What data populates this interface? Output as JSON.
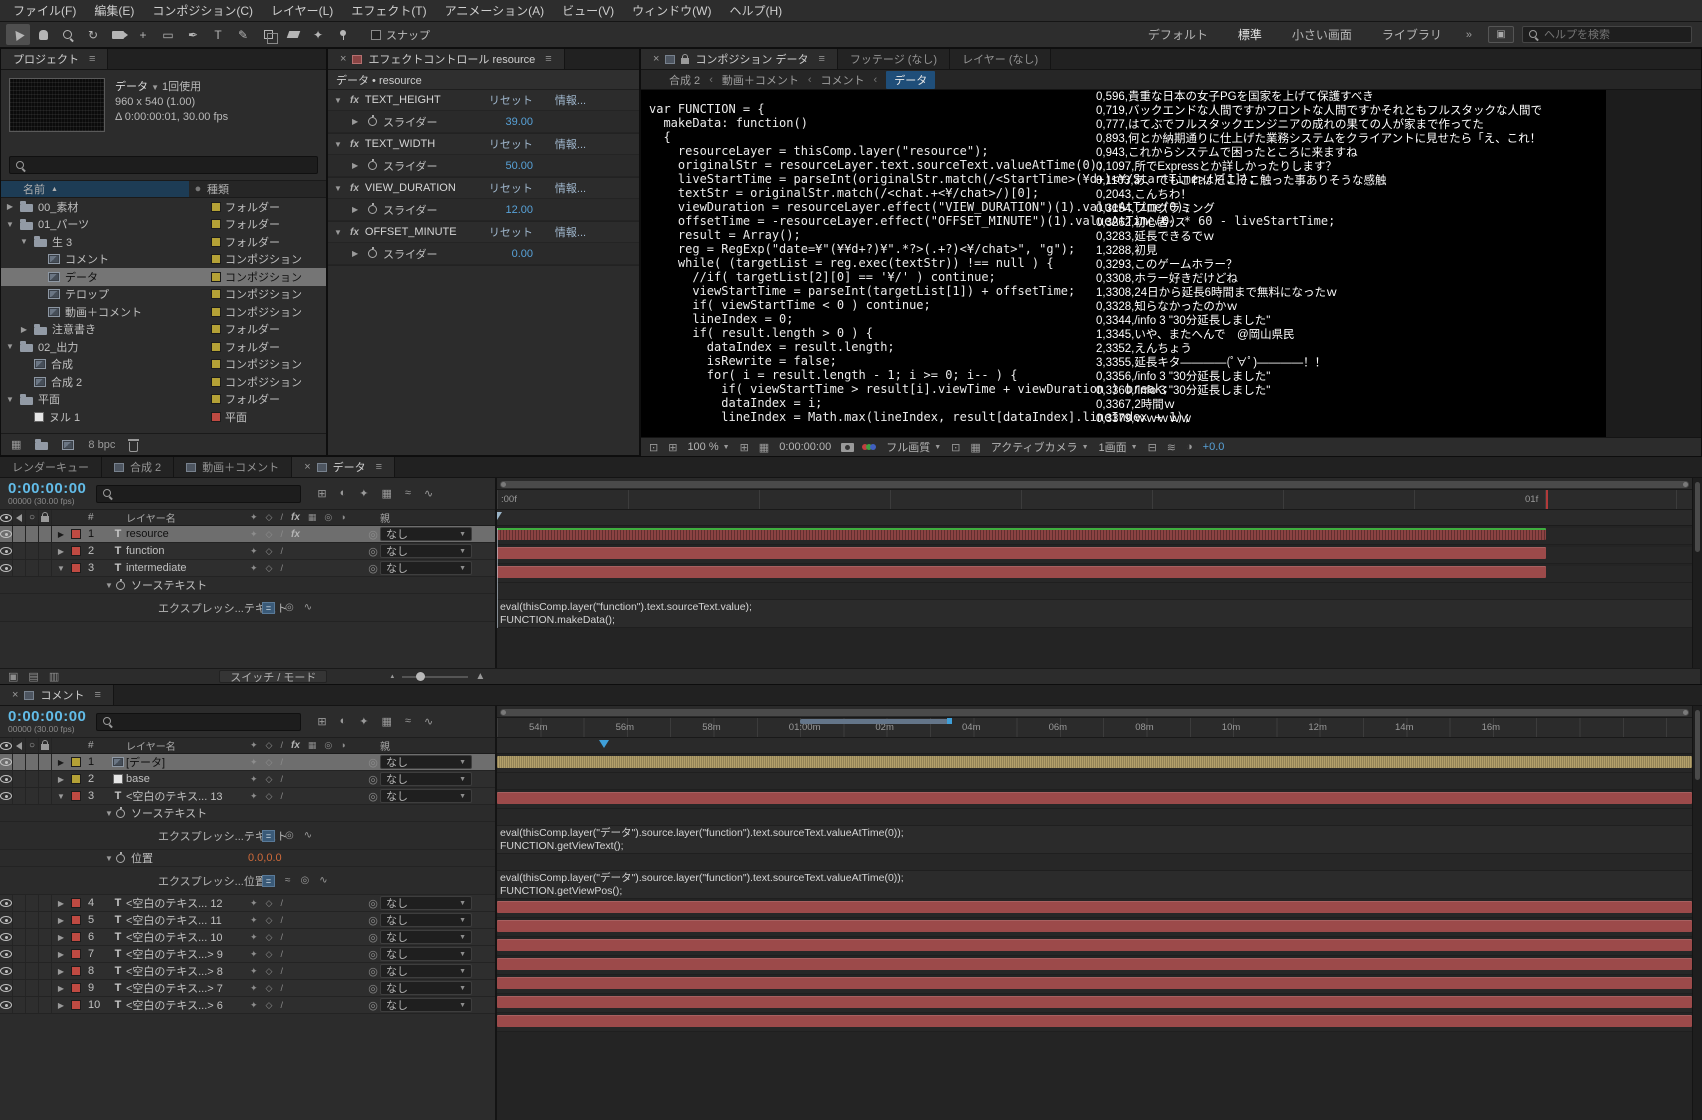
{
  "colors": {
    "accent_blue": "#3f9fd8",
    "time_cyan": "#62bce8",
    "bar_red": "#9c4a4a",
    "bar_tan": "#b3a06a",
    "bar_green_line": "#3fae3f",
    "label_red": "#bf4a42",
    "label_yellow": "#b4a136",
    "crumb_active_bg": "#1f4e79"
  },
  "icons": {
    "menu": "≡",
    "close": "×",
    "caret_down": "▼",
    "arrow_right": "▶",
    "arrow_down": "▼",
    "sort_asc": "▲",
    "pickwhip": "◎",
    "graph": "∿",
    "eq": "=",
    "wave": "≈",
    "crumb_sep": "‹",
    "overflow": "»",
    "solo": "○",
    "text_layer": "T",
    "switch_a": "✦",
    "switch_b": "◇",
    "switch_c": "/",
    "fx": "fx",
    "mon1": "⊡",
    "mon2": "⊞",
    "grid": "⊞",
    "roi": "⊡",
    "checker": "▦",
    "pixel_aspect": "⊟",
    "fast_prev": "≋",
    "exposure_icon": "◑",
    "panel_button": "▣",
    "tl_left1": "▣",
    "tl_left2": "▤",
    "tl_left3": "▥",
    "proj_icon1": "▦",
    "rotate": "↻"
  },
  "menubar": {
    "items": [
      "ファイル(F)",
      "編集(E)",
      "コンポジション(C)",
      "レイヤー(L)",
      "エフェクト(T)",
      "アニメーション(A)",
      "ビュー(V)",
      "ウィンドウ(W)",
      "ヘルプ(H)"
    ]
  },
  "toolbar": {
    "tools": [
      {
        "name": "selection-tool",
        "css": "i-cursor",
        "active": true
      },
      {
        "name": "hand-tool",
        "css": "i-hand"
      },
      {
        "name": "zoom-tool",
        "css": "i-magtool"
      },
      {
        "name": "rotation-tool",
        "glyph": "↻"
      },
      {
        "name": "camera-tool",
        "css": "i-camtool"
      },
      {
        "name": "pan-behind-tool",
        "glyph": "+"
      },
      {
        "name": "shape-tool",
        "glyph": "▭"
      },
      {
        "name": "pen-tool",
        "glyph": "✒"
      },
      {
        "name": "type-tool",
        "glyph": "T"
      },
      {
        "name": "brush-tool",
        "glyph": "✎"
      },
      {
        "name": "clone-stamp-tool",
        "css": "i-stamp"
      },
      {
        "name": "eraser-tool",
        "css": "i-eraser"
      },
      {
        "name": "roto-brush-tool",
        "glyph": "✦"
      },
      {
        "name": "puppet-pin-tool",
        "css": "i-pin"
      }
    ],
    "snap_label": "スナップ",
    "workspaces": [
      "デフォルト",
      "標準",
      "小さい画面",
      "ライブラリ"
    ],
    "search_placeholder": "ヘルプを検索"
  },
  "project": {
    "title": "プロジェクト",
    "selected_name": "データ",
    "usage": "1回使用",
    "dimensions": "960 x 540 (1.00)",
    "duration_fps": "Δ 0:00:00:01, 30.00 fps",
    "columns": {
      "name": "名前",
      "type": "種類"
    },
    "bpc": "8 bpc",
    "items": [
      {
        "depth": 0,
        "arrow": "right",
        "icon": "folder",
        "label": "00_素材",
        "type": "フォルダー",
        "swatch": "yellow"
      },
      {
        "depth": 0,
        "arrow": "down",
        "icon": "folder",
        "label": "01_パーツ",
        "type": "フォルダー",
        "swatch": "yellow"
      },
      {
        "depth": 1,
        "arrow": "down",
        "icon": "folder",
        "label": "生 3",
        "type": "フォルダー",
        "swatch": "yellow"
      },
      {
        "depth": 2,
        "icon": "comp",
        "label": "コメント",
        "type": "コンポジション",
        "swatch": "yellow"
      },
      {
        "depth": 2,
        "icon": "comp",
        "label": "データ",
        "type": "コンポジション",
        "swatch": "yellow",
        "selected": true
      },
      {
        "depth": 2,
        "icon": "comp",
        "label": "テロップ",
        "type": "コンポジション",
        "swatch": "yellow"
      },
      {
        "depth": 2,
        "icon": "comp",
        "label": "動画＋コメント",
        "type": "コンポジション",
        "swatch": "yellow"
      },
      {
        "depth": 1,
        "arrow": "right",
        "icon": "folder",
        "label": "注意書き",
        "type": "フォルダー",
        "swatch": "yellow"
      },
      {
        "depth": 0,
        "arrow": "down",
        "icon": "folder",
        "label": "02_出力",
        "type": "フォルダー",
        "swatch": "yellow"
      },
      {
        "depth": 1,
        "icon": "comp",
        "label": "合成",
        "type": "コンポジション",
        "swatch": "yellow"
      },
      {
        "depth": 1,
        "icon": "comp",
        "label": "合成 2",
        "type": "コンポジション",
        "swatch": "yellow"
      },
      {
        "depth": 0,
        "arrow": "down",
        "icon": "folder",
        "label": "平面",
        "type": "フォルダー",
        "swatch": "yellow"
      },
      {
        "depth": 1,
        "icon": "solid",
        "label": "ヌル 1",
        "type": "平面",
        "swatch": "red"
      }
    ]
  },
  "effects": {
    "tab_title": "エフェクトコントロール resource",
    "target": "データ • resource",
    "reset_label": "リセット",
    "info_label": "情報...",
    "slider_label": "スライダー",
    "items": [
      {
        "name": "TEXT_HEIGHT",
        "value": "39.00"
      },
      {
        "name": "TEXT_WIDTH",
        "value": "50.00"
      },
      {
        "name": "VIEW_DURATION",
        "value": "12.00"
      },
      {
        "name": "OFFSET_MINUTE",
        "value": "0.00"
      }
    ]
  },
  "composition": {
    "tab_title": "コンポジション データ",
    "tab_footage": "フッテージ (なし)",
    "tab_layer": "レイヤー (なし)",
    "breadcrumb": [
      "合成 2",
      "動画＋コメント",
      "コメント",
      "データ"
    ],
    "code_lines": [
      "var FUNCTION = {",
      "  makeData: function()",
      "  {",
      "    resourceLayer = thisComp.layer(\"resource\");",
      "    originalStr = resourceLayer.text.sourceText.valueAtTime(0);",
      "    liveStartTime = parseInt(originalStr.match(/<StartTime>(¥d+)<¥/StartTime>/)[1]);",
      "    textStr = originalStr.match(/<chat.+<¥/chat>/)[0];",
      "    viewDuration = resourceLayer.effect(\"VIEW_DURATION\")(1).valueAtTime(0);",
      "    offsetTime = -resourceLayer.effect(\"OFFSET_MINUTE\")(1).valueAtTime(0) * 60 - liveStartTime;",
      "    result = Array();",
      "    reg = RegExp(\"date=¥\"(¥¥d+?)¥\".*?>(.+?)<¥/chat>\", \"g\");",
      "    while( (targetList = reg.exec(textStr)) !== null ) {",
      "      //if( targetList[2][0] == '¥/' ) continue;",
      "      viewStartTime = parseInt(targetList[1]) + offsetTime;",
      "      if( viewStartTime < 0 ) continue;",
      "      lineIndex = 0;",
      "      if( result.length > 0 ) {",
      "        dataIndex = result.length;",
      "        isRewrite = false;",
      "        for( i = result.length - 1; i >= 0; i-- ) {",
      "          if( viewStartTime > result[i].viewTime + viewDuration ) break;",
      "          dataIndex = i;",
      "          lineIndex = Math.max(lineIndex, result[dataIndex].lineIndex + 1);"
    ],
    "data_lines": [
      "0,596,貴重な日本の女子PGを国家を上げて保護すべき",
      "0,719,バックエンドな人間ですかフロントな人間ですかそれともフルスタックな人間で",
      "0,777,はてぶでフルスタックエンジニアの成れの果ての人が家まで作ってた",
      "0,893,何とか納期通りに仕上げた業務システムをクライアントに見せたら「え、これ！",
      "0,943,これからシステムで困ったところに来ますね",
      "0,1097,所でExpressとか詳しかったりします？",
      "0,1103,あ、でもこれはそこそこ触った事ありそうな感触",
      "0,2043,こんちわ！",
      "0,3154,プログラミング",
      "0,3262,初心者ｯス",
      "0,3283,延長できるでｗ",
      "1,3288,初見",
      "0,3293,このゲームホラー？",
      "0,3308,ホラー好きだけどね",
      "1,3308,24日から延長6時間まで無料になったｗ",
      "0,3328,知らなかったのかｗ",
      "0,3344,/info 3 \"30分延長しました\"",
      "1,3345,いや、またへんで　@岡山県民",
      "2,3352,えんちょう",
      "3,3355,延長キタ――――(ﾟ∀ﾟ)――――！！",
      "0,3356,/info 3 \"30分延長しました\"",
      "0,3360,/info 3 \"30分延長しました\"",
      "0,3367,2時間ｗ",
      "0,3379,ｗｗｗｗｗ"
    ],
    "viewer_bar": {
      "zoom": "100 %",
      "time": "0:00:00:00",
      "quality": "フル画質",
      "camera": "アクティブカメラ",
      "view_layout": "1画面",
      "exposure": "+0.0"
    }
  },
  "timeline_tools": [
    {
      "name": "comp-mini-flowchart-icon",
      "glyph": "⊞"
    },
    {
      "name": "draft-3d-icon",
      "glyph": "◐"
    },
    {
      "name": "hide-shy-layers-icon",
      "glyph": "✦"
    },
    {
      "name": "frame-blend-icon",
      "glyph": "▦"
    },
    {
      "name": "motion-blur-icon",
      "glyph": "≈"
    },
    {
      "name": "graph-editor-icon",
      "glyph": "∿"
    }
  ],
  "header_switches": [
    "✦",
    "◇",
    "/",
    "fx",
    "▦",
    "◎",
    "◑"
  ],
  "tl1": {
    "tabs": [
      {
        "label": "レンダーキュー"
      },
      {
        "label": "合成 2",
        "icon": true
      },
      {
        "label": "動画＋コメント",
        "icon": true
      },
      {
        "label": "データ",
        "icon": true,
        "active": true
      }
    ],
    "time": "0:00:00:00",
    "frame_info": "00000 (30.00 fps)",
    "ruler_start": ":00f",
    "ruler_end": "01f",
    "col_num": "#",
    "col_name": "レイヤー名",
    "col_parent": "親",
    "switches_label": "スイッチ / モード",
    "rows": [
      {
        "kind": "layer",
        "arrow": "right",
        "num": "1",
        "icon": "text",
        "name": "resource",
        "parent": "なし",
        "selected": true,
        "label_color": "red",
        "fx": true,
        "bar": "red-sel"
      },
      {
        "kind": "layer",
        "arrow": "right",
        "num": "2",
        "icon": "text",
        "name": "function",
        "parent": "なし",
        "label_color": "red",
        "bar": "red"
      },
      {
        "kind": "layer",
        "arrow": "down",
        "num": "3",
        "icon": "text",
        "name": "intermediate",
        "parent": "なし",
        "label_color": "red",
        "bar": "red"
      },
      {
        "kind": "prop",
        "label": "ソーステキスト"
      },
      {
        "kind": "expr",
        "label": "エクスプレッシ...テキスト",
        "lines": [
          "eval(thisComp.layer(\"function\").text.sourceText.value);",
          "FUNCTION.makeData();"
        ],
        "icons": [
          "eq",
          "pickwhip",
          "graph"
        ]
      }
    ]
  },
  "tl2": {
    "tab_label": "コメント",
    "time": "0:00:00:00",
    "frame_info": "00000 (30.00 fps)",
    "col_num": "#",
    "col_name": "レイヤー名",
    "col_parent": "親",
    "ruler_ticks": [
      "54m",
      "56m",
      "58m",
      "01:00m",
      "02m",
      "04m",
      "06m",
      "08m",
      "10m",
      "12m",
      "14m",
      "16m"
    ],
    "rows": [
      {
        "kind": "layer",
        "arrow": "right",
        "num": "1",
        "icon": "comp",
        "name": "[データ]",
        "parent": "なし",
        "selected": true,
        "label_color": "yellow",
        "bar": "tan"
      },
      {
        "kind": "layer",
        "arrow": "right",
        "num": "2",
        "icon": "solid",
        "name": "base",
        "parent": "なし",
        "label_color": "yellow",
        "bar": "none"
      },
      {
        "kind": "layer",
        "arrow": "down",
        "num": "3",
        "icon": "text",
        "name": "<空白のテキス... 13",
        "parent": "なし",
        "label_color": "red",
        "bar": "red"
      },
      {
        "kind": "prop",
        "label": "ソーステキスト"
      },
      {
        "kind": "expr",
        "label": "エクスプレッシ...テキスト",
        "lines": [
          "eval(thisComp.layer(\"データ\").source.layer(\"function\").text.sourceText.valueAtTime(0));",
          "FUNCTION.getViewText();"
        ],
        "icons": [
          "eq",
          "pickwhip",
          "graph"
        ]
      },
      {
        "kind": "prop",
        "label": "位置",
        "value": "0.0,0.0"
      },
      {
        "kind": "expr",
        "label": "エクスプレッシ...位置",
        "lines": [
          "eval(thisComp.layer(\"データ\").source.layer(\"function\").text.sourceText.valueAtTime(0));",
          "FUNCTION.getViewPos();"
        ],
        "icons": [
          "eq",
          "wave",
          "pickwhip",
          "graph"
        ]
      },
      {
        "kind": "layer",
        "arrow": "right",
        "num": "4",
        "icon": "text",
        "name": "<空白のテキス... 12",
        "parent": "なし",
        "label_color": "red",
        "bar": "red"
      },
      {
        "kind": "layer",
        "arrow": "right",
        "num": "5",
        "icon": "text",
        "name": "<空白のテキス... 11",
        "parent": "なし",
        "label_color": "red",
        "bar": "red"
      },
      {
        "kind": "layer",
        "arrow": "right",
        "num": "6",
        "icon": "text",
        "name": "<空白のテキス... 10",
        "parent": "なし",
        "label_color": "red",
        "bar": "red"
      },
      {
        "kind": "layer",
        "arrow": "right",
        "num": "7",
        "icon": "text",
        "name": "<空白のテキス...> 9",
        "parent": "なし",
        "label_color": "red",
        "bar": "red"
      },
      {
        "kind": "layer",
        "arrow": "right",
        "num": "8",
        "icon": "text",
        "name": "<空白のテキス...> 8",
        "parent": "なし",
        "label_color": "red",
        "bar": "red"
      },
      {
        "kind": "layer",
        "arrow": "right",
        "num": "9",
        "icon": "text",
        "name": "<空白のテキス...> 7",
        "parent": "なし",
        "label_color": "red",
        "bar": "red"
      },
      {
        "kind": "layer",
        "arrow": "right",
        "num": "10",
        "icon": "text",
        "name": "<空白のテキス...> 6",
        "parent": "なし",
        "label_color": "red",
        "bar": "red"
      }
    ]
  }
}
